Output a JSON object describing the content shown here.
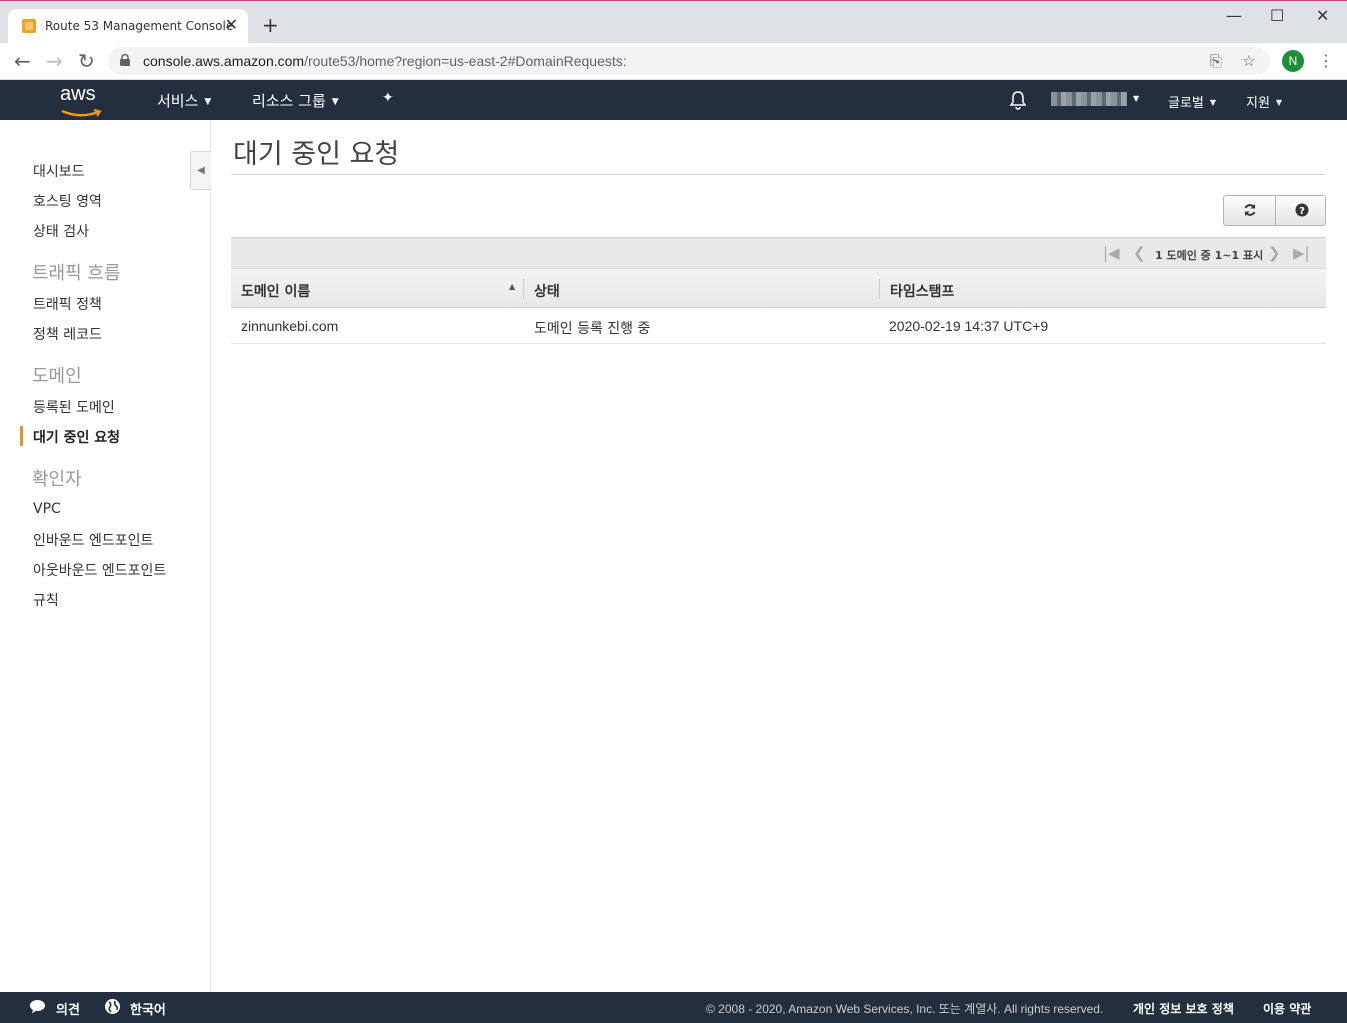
{
  "browser": {
    "tab_title": "Route 53 Management Console",
    "tab_close": "✕",
    "new_tab": "+",
    "win_minimize": "—",
    "win_maximize": "☐",
    "win_close": "✕",
    "url_host": "console.aws.amazon.com",
    "url_path": "/route53/home?region=us-east-2#DomainRequests:",
    "profile_initial": "N"
  },
  "header": {
    "logo": "aws",
    "services": "서비스",
    "resource_groups": "리소스 그룹",
    "username": "",
    "region": "글로벌",
    "support": "지원"
  },
  "sidebar": {
    "items": [
      {
        "label": "대시보드"
      },
      {
        "label": "호스팅 영역"
      },
      {
        "label": "상태 검사"
      },
      {
        "label": "트래픽 흐름"
      },
      {
        "label": "트래픽 정책"
      },
      {
        "label": "정책 레코드"
      },
      {
        "label": "도메인"
      },
      {
        "label": "등록된 도메인"
      },
      {
        "label": "대기 중인 요청"
      },
      {
        "label": "확인자"
      },
      {
        "label": "VPC"
      },
      {
        "label": "인바운드 엔드포인트"
      },
      {
        "label": "아웃바운드 엔드포인트"
      },
      {
        "label": "규칙"
      }
    ],
    "active": "대기 중인 요청"
  },
  "main": {
    "title": "대기 중인 요청",
    "pager_text": "1 도메인 중 1~1 표시",
    "columns": [
      "도메인 이름",
      "상태",
      "타임스탬프"
    ],
    "rows": [
      {
        "domain": "zinnunkebi.com",
        "status": "도메인 등록 진행 중",
        "timestamp": "2020-02-19 14:37 UTC+9"
      }
    ]
  },
  "footer": {
    "feedback": "의견",
    "language": "한국어",
    "copyright": "© 2008 - 2020, Amazon Web Services, Inc. 또는 계열사. All rights reserved.",
    "privacy": "개인 정보 보호 정책",
    "terms": "이용 약관"
  },
  "colors": {
    "aws_navy": "#232f3e",
    "accent_orange": "#e8912d"
  }
}
